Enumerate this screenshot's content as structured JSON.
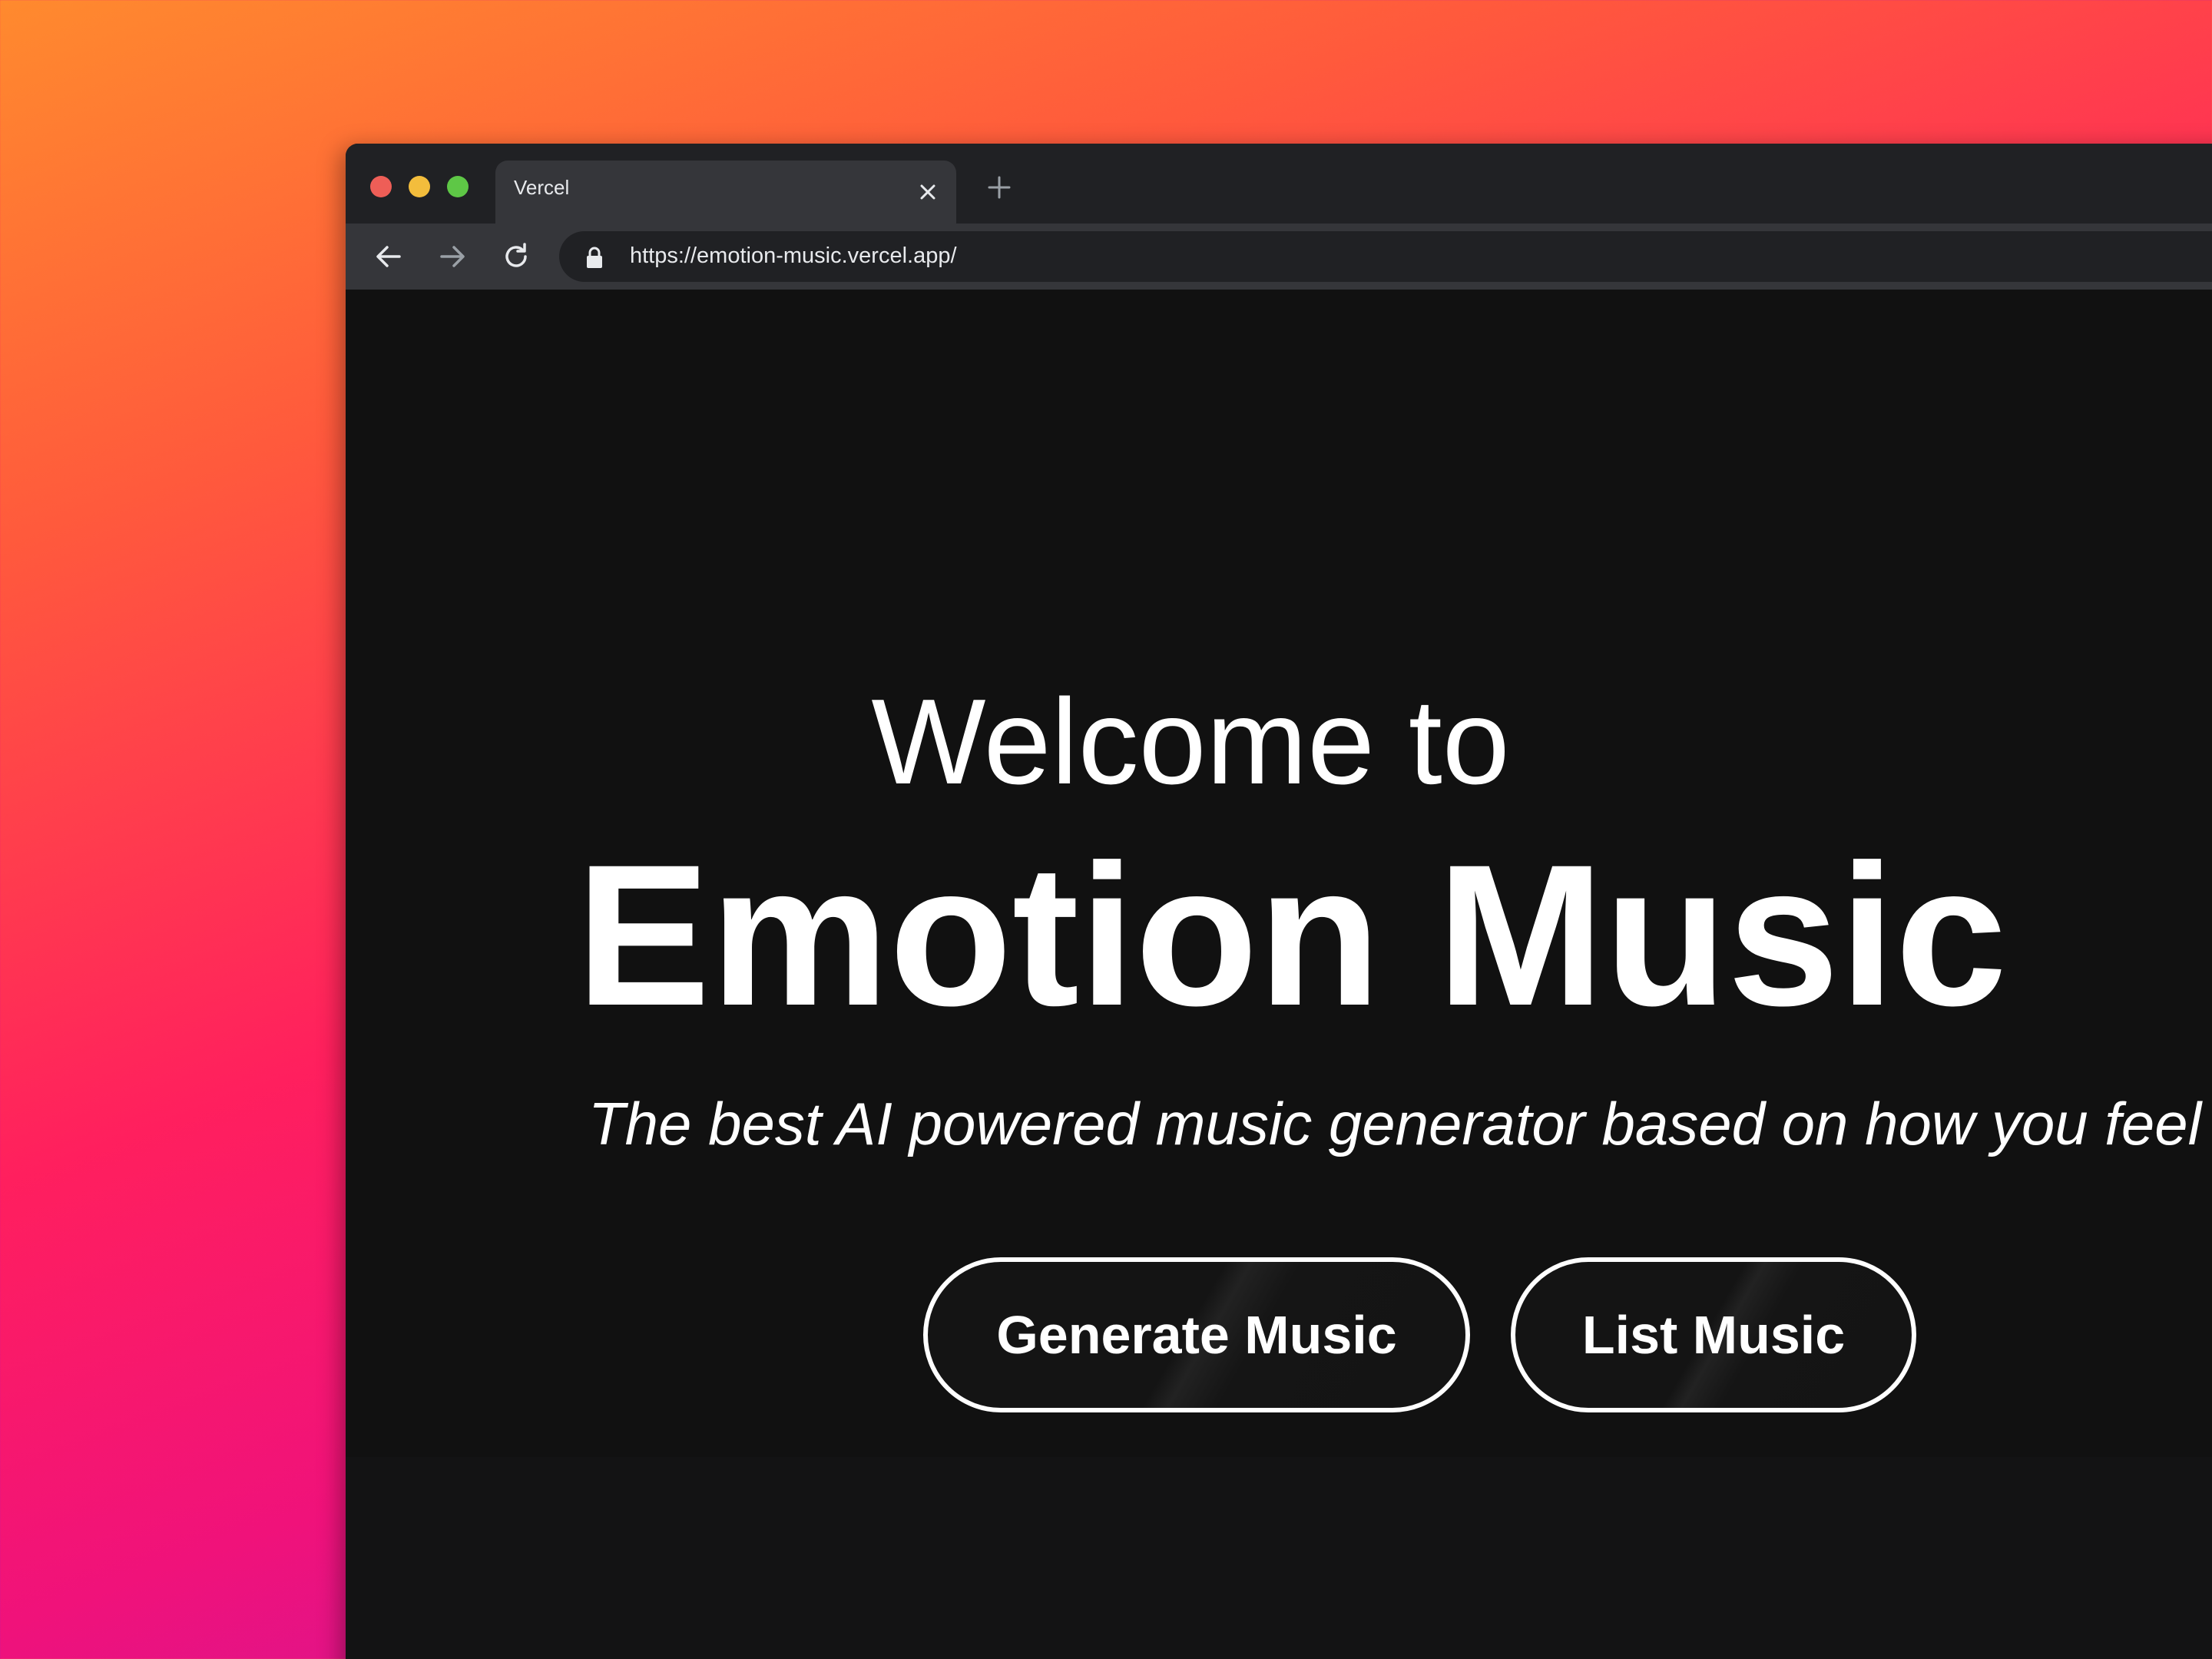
{
  "browser": {
    "tab_title": "Vercel",
    "url": "https://emotion-music.vercel.app/",
    "icons": {
      "close_window": "red-traffic-light",
      "minimize_window": "yellow-traffic-light",
      "maximize_window": "green-traffic-light",
      "tab_close": "close-icon",
      "new_tab": "plus-icon",
      "back": "arrow-left-icon",
      "forward": "arrow-right-icon",
      "reload": "reload-icon",
      "secure": "lock-icon"
    }
  },
  "hero": {
    "welcome": "Welcome to",
    "brand": "Emotion Music",
    "tagline": "The best AI powered music generator based on how you feel"
  },
  "actions": {
    "generate_label": "Generate Music",
    "list_label": "List Music"
  },
  "colors": {
    "page_background": "#111111",
    "tab_bar": "#202124",
    "toolbar": "#35363a",
    "text": "#ffffff",
    "button_border": "#ffffff"
  }
}
